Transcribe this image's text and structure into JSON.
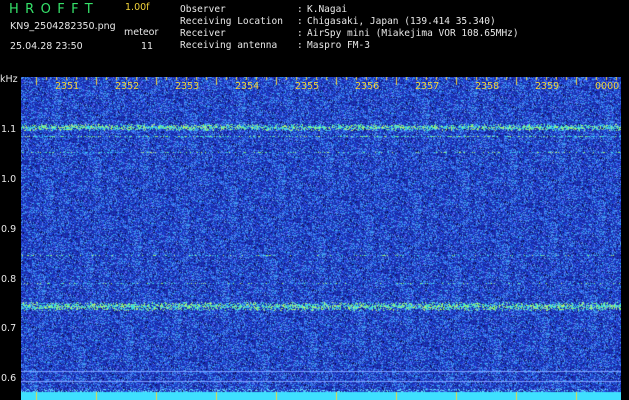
{
  "header": {
    "app_title": "HROFFT",
    "version": "1.00f",
    "filename": "KN9_2504282350.png",
    "datetime": "25.04.28 23:50",
    "meteor_label": "meteor",
    "meteor_count": "11"
  },
  "info": [
    {
      "label": "Observer",
      "value": "K.Nagai"
    },
    {
      "label": "Receiving Location",
      "value": "Chigasaki, Japan (139.414 35.340)"
    },
    {
      "label": "Receiver",
      "value": "AirSpy mini (Miakejima VOR 108.65MHz)"
    },
    {
      "label": "Receiving antenna",
      "value": "Maspro FM-3"
    }
  ],
  "spectrogram": {
    "unit_label": "kHz",
    "y_ticks": [
      "1.1",
      "1.0",
      "0.9",
      "0.8",
      "0.7",
      "0.6"
    ],
    "time_labels": [
      "2351",
      "2352",
      "2353",
      "2354",
      "2355",
      "2356",
      "2357",
      "2358",
      "2359",
      "0000"
    ],
    "colors": {
      "background": "#1a2aa8",
      "noise": "#3f7bff",
      "signal": "#7cff6a",
      "footer_bar": "#3fe0ff",
      "tick": "#f2d43a"
    }
  }
}
